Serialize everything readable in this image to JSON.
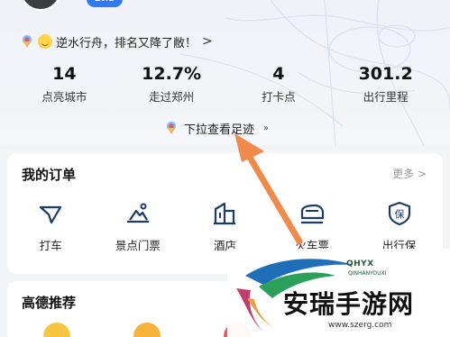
{
  "header": {
    "level_badge": "Lv.3",
    "slogan": "逆水行舟，排名又降了敝！",
    "slogan_chevron": ">"
  },
  "stats": [
    {
      "value": "14",
      "label": "点亮城市"
    },
    {
      "value": "12.7%",
      "label": "走过郑州"
    },
    {
      "value": "4",
      "label": "打卡点"
    },
    {
      "value": "301.2",
      "label": "出行里程"
    }
  ],
  "pull_hint": {
    "label": "下拉查看足迹",
    "chevron": "»"
  },
  "orders": {
    "title": "我的订单",
    "more_label": "更多 >",
    "items": [
      {
        "label": "打车",
        "icon": "taxi-icon"
      },
      {
        "label": "景点门票",
        "icon": "scenic-ticket-icon"
      },
      {
        "label": "酒店",
        "icon": "hotel-icon"
      },
      {
        "label": "火车票",
        "icon": "train-icon"
      },
      {
        "label": "出行保",
        "icon": "insurance-icon"
      }
    ]
  },
  "recommend": {
    "title": "高德推荐"
  },
  "watermark": {
    "brand_top": "QHYX",
    "brand_sub": "QINHANYOUXI",
    "title": "安瑞手游网",
    "url": "www.szerg.com"
  },
  "colors": {
    "accent_blue": "#2f7bf6",
    "arrow_orange": "#ef8a4a",
    "icon_blue": "#1c3d63"
  }
}
